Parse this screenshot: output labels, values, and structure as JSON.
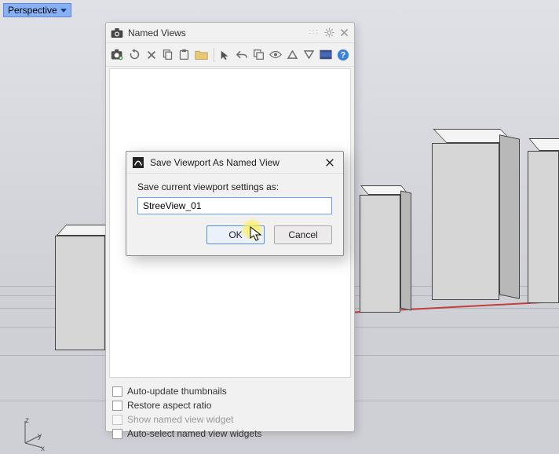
{
  "viewport_tab": {
    "label": "Perspective"
  },
  "panel": {
    "title": "Named Views",
    "footer": {
      "auto_update_thumbnails": "Auto-update thumbnails",
      "restore_aspect_ratio": "Restore aspect ratio",
      "show_named_view_widget": "Show named view widget",
      "auto_select_named_view_widgets": "Auto-select named view widgets"
    }
  },
  "dialog": {
    "title": "Save Viewport As Named View",
    "prompt": "Save current viewport settings as:",
    "input_value": "StreeView_01",
    "ok_label": "OK",
    "cancel_label": "Cancel"
  },
  "axis": {
    "x": "x",
    "y": "y",
    "z": "z"
  }
}
